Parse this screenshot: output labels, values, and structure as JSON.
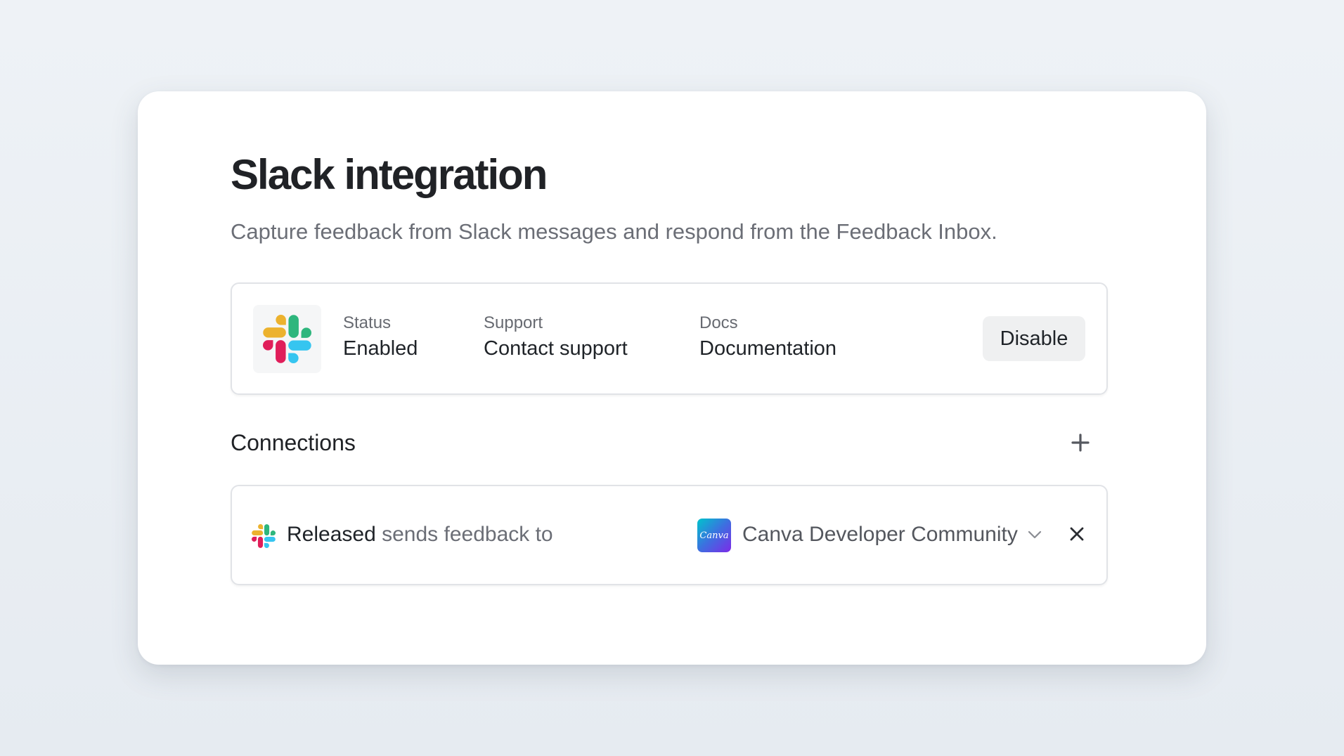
{
  "header": {
    "title": "Slack integration",
    "subtitle": "Capture feedback from Slack messages and respond from the Feedback Inbox."
  },
  "integration": {
    "logo_icon": "slack-logo-icon",
    "status": {
      "label": "Status",
      "value": "Enabled"
    },
    "support": {
      "label": "Support",
      "value": "Contact support"
    },
    "docs": {
      "label": "Docs",
      "value": "Documentation"
    },
    "disable_label": "Disable"
  },
  "connections": {
    "title": "Connections",
    "add_icon": "plus-icon",
    "items": [
      {
        "source_icon": "slack-logo-icon",
        "source_name": "Released",
        "connector_text": "sends feedback to",
        "target_logo_text": "Canva",
        "target_name": "Canva Developer Community",
        "dropdown_icon": "chevron-down-icon",
        "remove_icon": "close-icon"
      }
    ]
  },
  "colors": {
    "slack_blue": "#36C5F0",
    "slack_green": "#2EB67D",
    "slack_red": "#E01E5A",
    "slack_yellow": "#ECB22E"
  }
}
